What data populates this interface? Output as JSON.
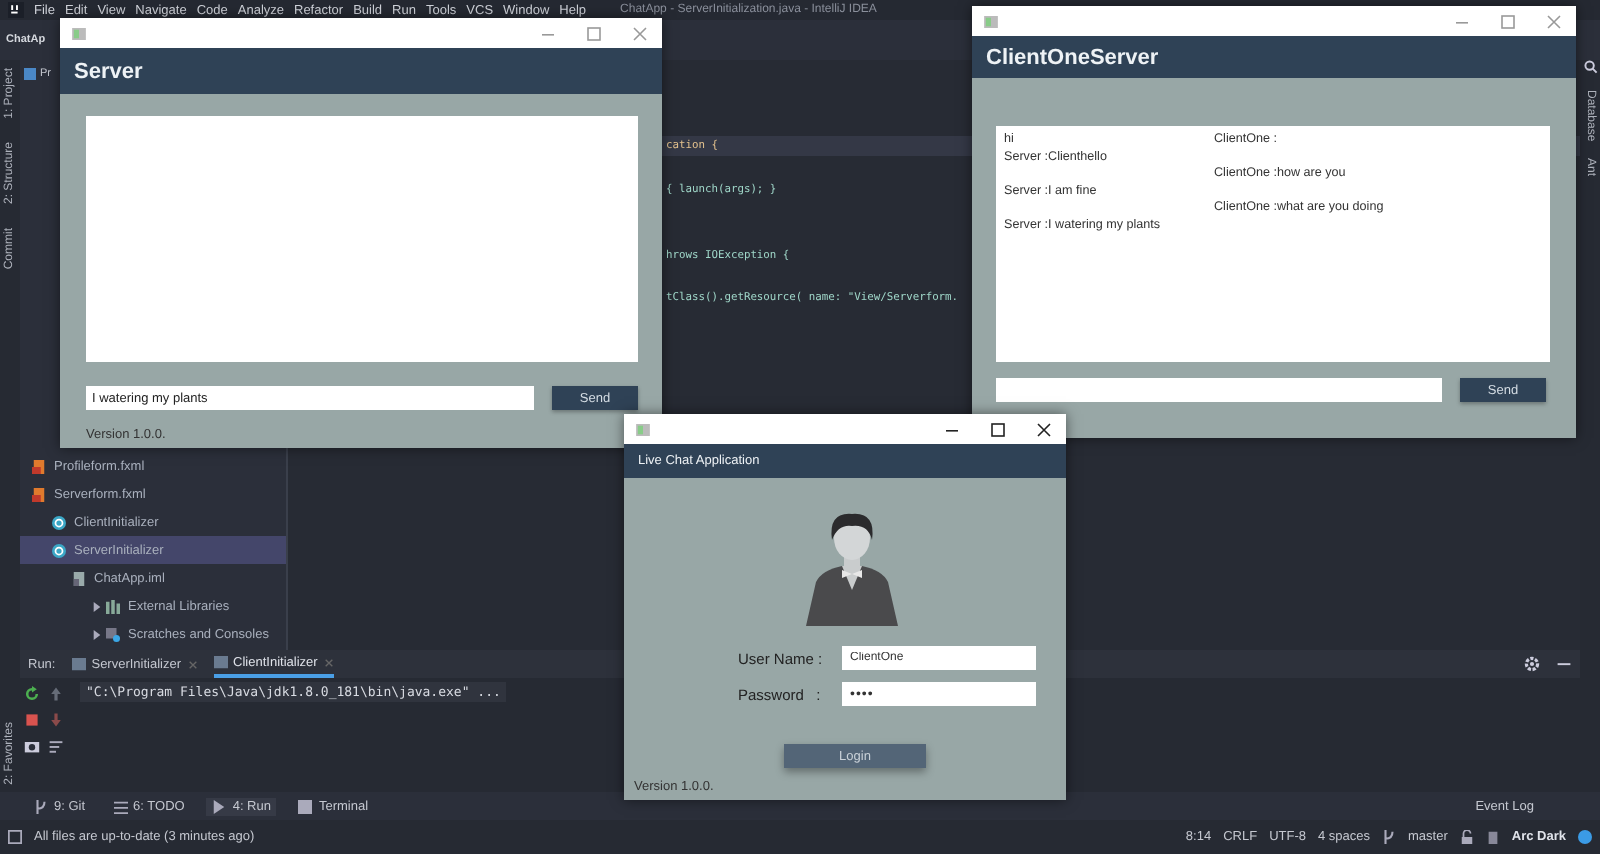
{
  "ide": {
    "title": "ChatApp - ServerInitialization.java - IntelliJ IDEA",
    "menu": [
      "File",
      "Edit",
      "View",
      "Navigate",
      "Code",
      "Analyze",
      "Refactor",
      "Build",
      "Run",
      "Tools",
      "VCS",
      "Window",
      "Help"
    ],
    "breadcrumb": "ChatAp",
    "project_label": "Pr",
    "left_tabs": [
      "1: Project",
      "2: Structure",
      "Commit"
    ],
    "bottom_left_tab": "2: Favorites",
    "right_tabs": [
      "Database",
      "Ant"
    ],
    "code_lines": [
      {
        "text": "cation {",
        "highlighted": true
      },
      {
        "text": "{ launch(args); }",
        "highlighted": false
      },
      {
        "text": "hrows IOException {",
        "highlighted": false
      },
      {
        "text": "tClass().getResource( name: \"View/Serverform.",
        "highlighted": false
      }
    ],
    "project_tree": [
      {
        "children": [
          {
            "children": [
              {
                "children": [
                  {
                    "label": "Profileform.fxml",
                    "kind": "fxml",
                    "selected": false
                  },
                  {
                    "label": "Serverform.fxml",
                    "kind": "fxml",
                    "selected": false
                  }
                ]
              },
              {
                "label": "ClientInitializer",
                "kind": "class",
                "selected": false
              },
              {
                "label": "ServerInitializer",
                "kind": "class",
                "selected": true
              }
            ]
          },
          {
            "label": "ChatApp.iml",
            "kind": "iml",
            "selected": false
          }
        ]
      },
      {
        "label": "External Libraries",
        "kind": "libraries",
        "selected": false
      },
      {
        "label": "Scratches and Consoles",
        "kind": "scratches",
        "selected": false
      }
    ],
    "run_panel": {
      "label": "Run:",
      "tabs": [
        {
          "label": "ServerInitializer",
          "selected": false
        },
        {
          "label": "ClientInitializer",
          "selected": true
        }
      ],
      "output": "\"C:\\Program Files\\Java\\jdk1.8.0_181\\bin\\java.exe\" ..."
    },
    "tool_tabs": [
      {
        "label": "9: Git",
        "kind": "git",
        "selected": false
      },
      {
        "label": "6: TODO",
        "kind": "todo",
        "selected": false
      },
      {
        "label": "4: Run",
        "kind": "run",
        "selected": true
      },
      {
        "label": "Terminal",
        "kind": "terminal",
        "selected": false
      }
    ],
    "event_log": "Event Log",
    "status_bar": {
      "message": "All files are up-to-date (3 minutes ago)",
      "items": [
        "8:14",
        "CRLF",
        "UTF-8",
        "4 spaces"
      ],
      "branch": "master",
      "theme": "Arc Dark"
    }
  },
  "server_window": {
    "title": "Server",
    "input_value": "I watering my plants",
    "send": "Send",
    "version": "Version 1.0.0."
  },
  "client_window": {
    "title": "ClientOneServer",
    "lines": [
      {
        "left": "hi",
        "right": "ClientOne :"
      },
      {
        "left": "Server :Clienthello"
      },
      {
        "right": "ClientOne :how are you"
      },
      {
        "left": "Server :I am fine"
      },
      {
        "right": "ClientOne :what are you doing"
      },
      {
        "left": "Server :I watering my plants"
      }
    ],
    "send": "Send"
  },
  "login_window": {
    "header": "Live Chat Application",
    "username_label": "User Name :",
    "username_value": "ClientOne",
    "password_label": "Password   :",
    "password_value": "••••",
    "login": "Login",
    "version": "Version 1.0.0."
  }
}
